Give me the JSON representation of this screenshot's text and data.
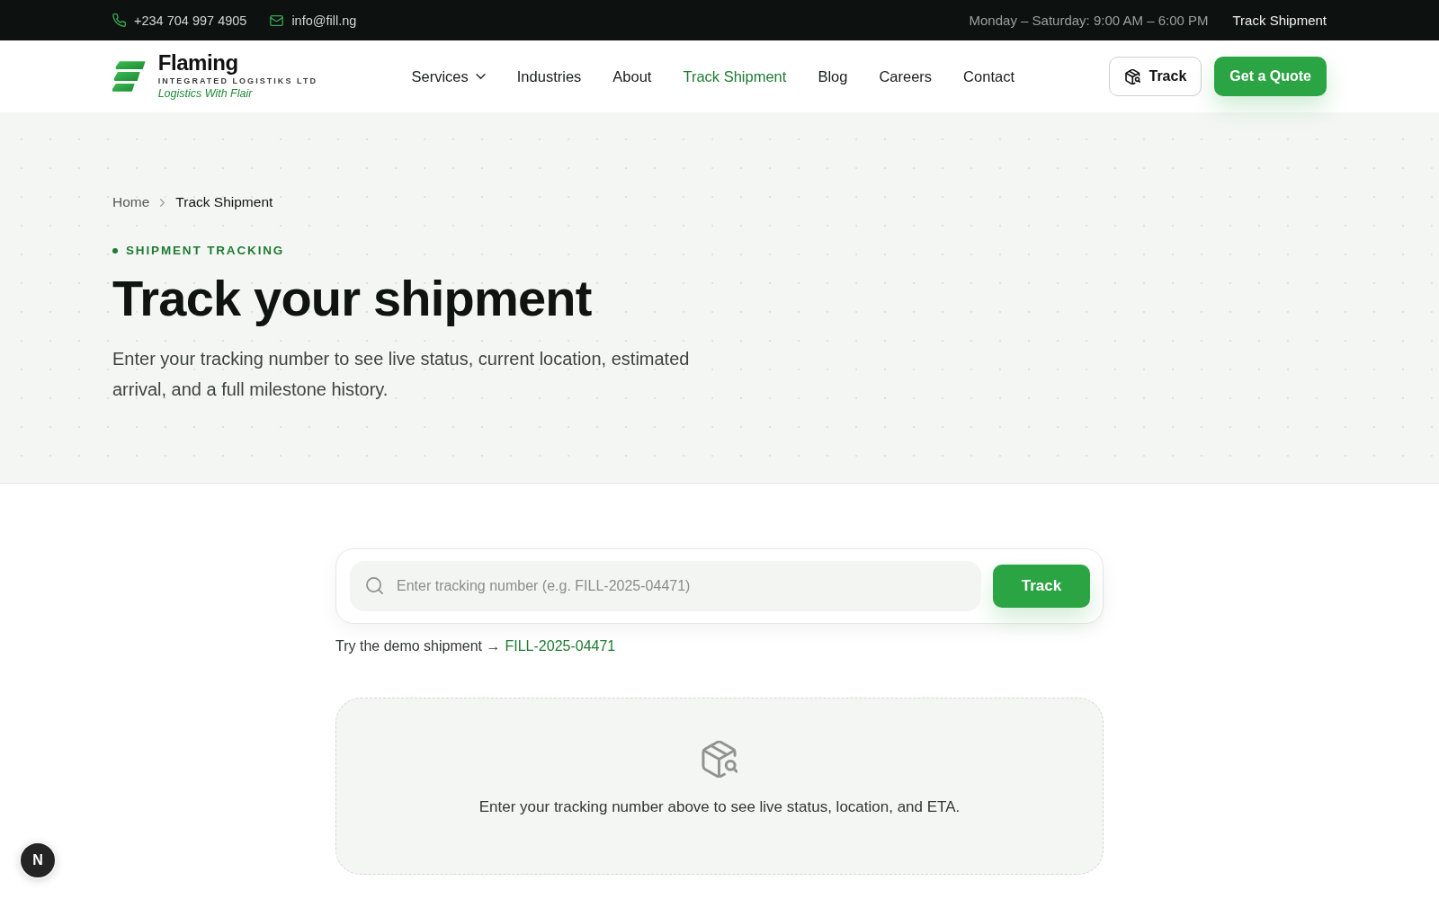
{
  "top_bar": {
    "phone": "+234 704 997 4905",
    "email": "info@fill.ng",
    "hours": "Monday – Saturday: 9:00 AM – 6:00 PM",
    "link": "Track Shipment"
  },
  "header": {
    "logo": {
      "name": "Flaming",
      "subtitle": "INTEGRATED LOGISTIKS LTD",
      "tagline": "Logistics With Flair"
    },
    "nav": [
      {
        "label": "Services",
        "kind": "dropdown",
        "selected": false
      },
      {
        "label": "Industries",
        "kind": "link",
        "selected": false
      },
      {
        "label": "About",
        "kind": "link",
        "selected": false
      },
      {
        "label": "Track Shipment",
        "kind": "link",
        "selected": true
      },
      {
        "label": "Blog",
        "kind": "link",
        "selected": false
      },
      {
        "label": "Careers",
        "kind": "link",
        "selected": false
      },
      {
        "label": "Contact",
        "kind": "link",
        "selected": false
      }
    ],
    "buttons": [
      {
        "label": "Track",
        "kind": "outline"
      },
      {
        "label": "Get a Quote",
        "kind": "primary"
      }
    ]
  },
  "hero": {
    "breadcrumb": [
      {
        "label": "Home",
        "current": false
      },
      {
        "label": "Track Shipment",
        "current": true
      }
    ],
    "eyebrow": "SHIPMENT TRACKING",
    "title": "Track your shipment",
    "description": "Enter your tracking number to see live status, current location, estimated arrival, and a full milestone history."
  },
  "tracker": {
    "search": {
      "placeholder": "Enter tracking number (e.g. FILL-2025-04471)"
    },
    "button": "Track",
    "demo": {
      "text": "Try the demo shipment →",
      "link": "FILL-2025-04471"
    }
  },
  "empty_state": {
    "message": "Enter your tracking number above to see live status, location, and ETA."
  },
  "dev_badge": {
    "label": "N"
  }
}
